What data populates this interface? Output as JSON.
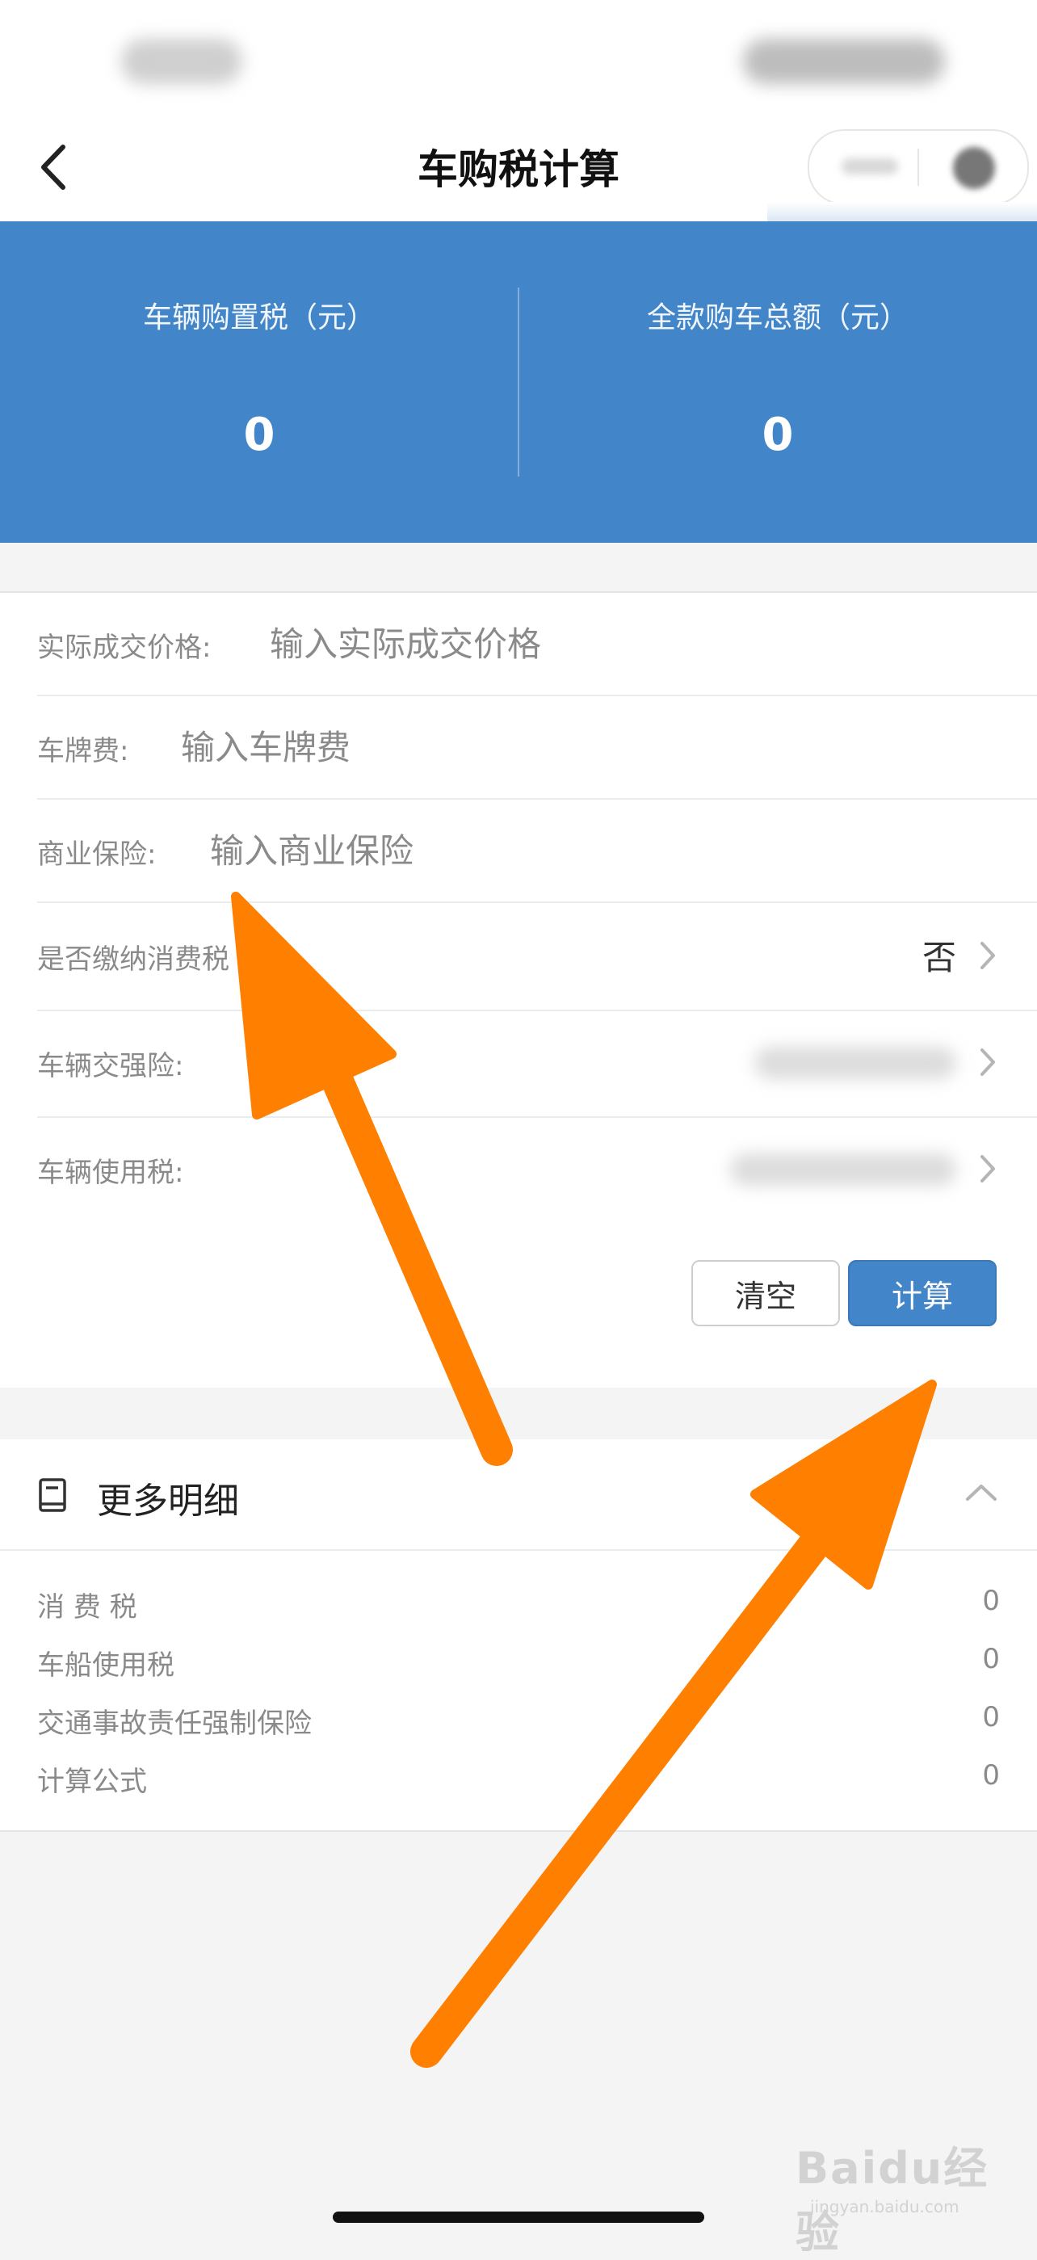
{
  "header": {
    "title": "车购税计算"
  },
  "summary": {
    "purchase_tax_label": "车辆购置税（元）",
    "purchase_tax_value": "0",
    "total_label": "全款购车总额（元）",
    "total_value": "0"
  },
  "form": {
    "price_label": "实际成交价格:",
    "price_placeholder": "输入实际成交价格",
    "plate_fee_label": "车牌费:",
    "plate_fee_placeholder": "输入车牌费",
    "commercial_insurance_label": "商业保险:",
    "commercial_insurance_placeholder": "输入商业保险",
    "consumption_tax_label": "是否缴纳消费税",
    "consumption_tax_value": "否",
    "compulsory_insurance_label": "车辆交强险:",
    "vehicle_use_tax_label": "车辆使用税:"
  },
  "buttons": {
    "clear": "清空",
    "calculate": "计算"
  },
  "details": {
    "title": "更多明细",
    "rows": [
      {
        "label": "消 费 税",
        "value": "0"
      },
      {
        "label": "车船使用税",
        "value": "0"
      },
      {
        "label": "交通事故责任强制保险",
        "value": "0"
      },
      {
        "label": "计算公式",
        "value": "0"
      }
    ]
  },
  "watermark": {
    "brand": "Baidu经验",
    "domain": "jingyan.baidu.com"
  },
  "colors": {
    "accent": "#4285c8",
    "arrow": "#ff7f00"
  }
}
